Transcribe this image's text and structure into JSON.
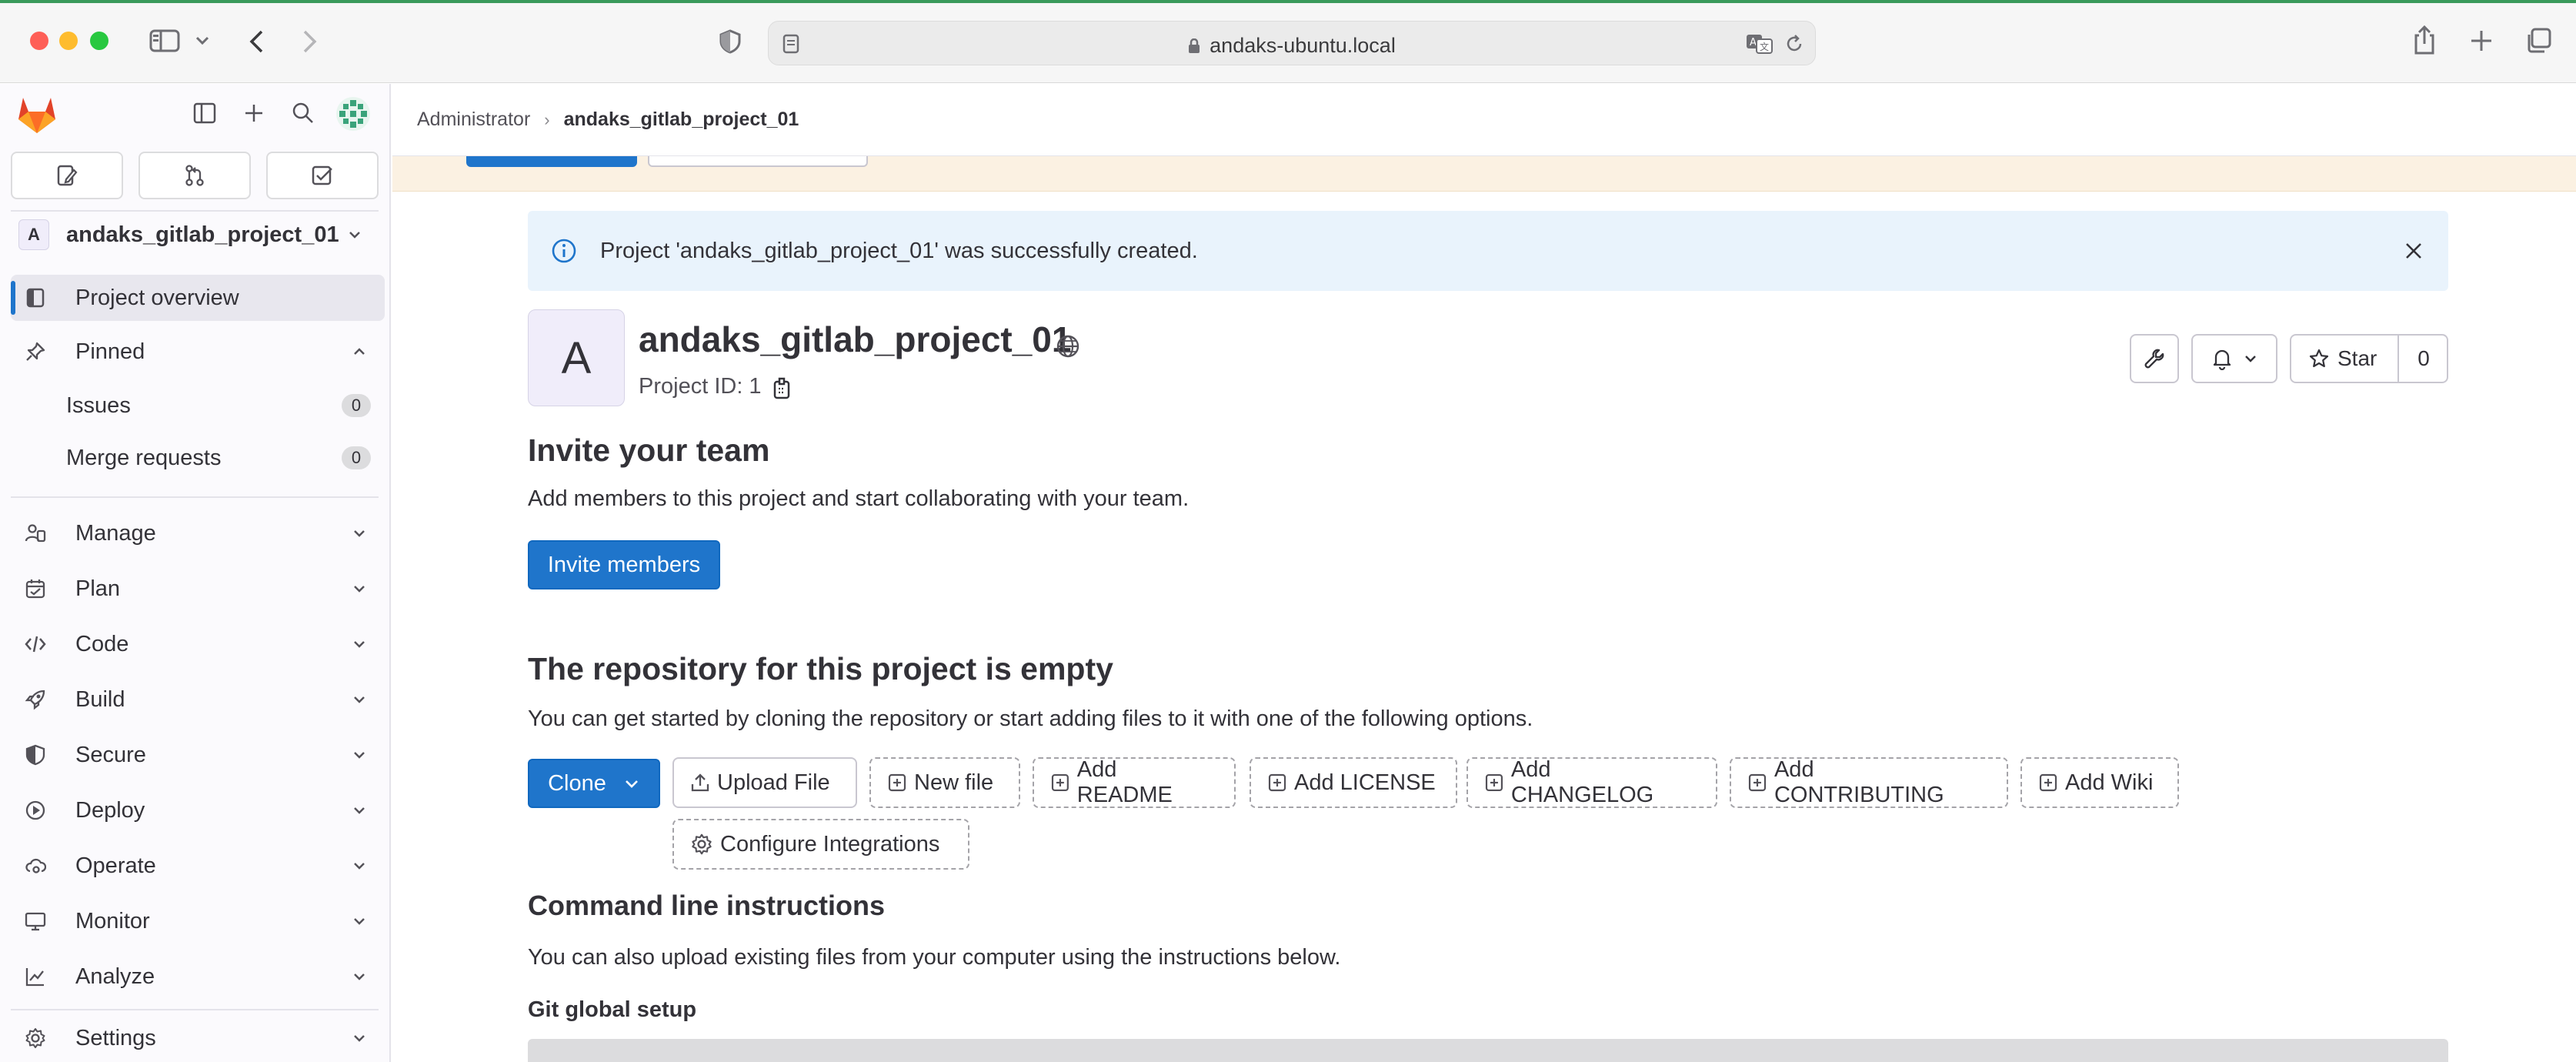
{
  "browser": {
    "url": "andaks-ubuntu.local"
  },
  "breadcrumb": {
    "root": "Administrator",
    "separator": "›",
    "current": "andaks_gitlab_project_01"
  },
  "sidebar": {
    "project_initial": "A",
    "project_name": "andaks_gitlab_project_01",
    "overview_label": "Project overview",
    "pinned_label": "Pinned",
    "pinned_items": [
      {
        "label": "Issues",
        "count": "0"
      },
      {
        "label": "Merge requests",
        "count": "0"
      }
    ],
    "sections": [
      {
        "label": "Manage",
        "icon": "users-icon"
      },
      {
        "label": "Plan",
        "icon": "calendar-icon"
      },
      {
        "label": "Code",
        "icon": "code-icon"
      },
      {
        "label": "Build",
        "icon": "rocket-icon"
      },
      {
        "label": "Secure",
        "icon": "shield-icon"
      },
      {
        "label": "Deploy",
        "icon": "deployments-icon"
      },
      {
        "label": "Operate",
        "icon": "cloud-gear-icon"
      },
      {
        "label": "Monitor",
        "icon": "monitor-icon"
      },
      {
        "label": "Analyze",
        "icon": "chart-icon"
      },
      {
        "label": "Settings",
        "icon": "gear-icon"
      }
    ]
  },
  "alert": {
    "message": "Project 'andaks_gitlab_project_01' was successfully created."
  },
  "project": {
    "initial": "A",
    "title": "andaks_gitlab_project_01",
    "id_label": "Project ID: 1",
    "star_label": "Star",
    "star_count": "0"
  },
  "invite": {
    "heading": "Invite your team",
    "description": "Add members to this project and start collaborating with your team.",
    "button": "Invite members"
  },
  "empty_repo": {
    "heading": "The repository for this project is empty",
    "description": "You can get started by cloning the repository or start adding files to it with one of the following options.",
    "clone_label": "Clone",
    "upload_label": "Upload File",
    "actions": [
      "New file",
      "Add README",
      "Add LICENSE",
      "Add CHANGELOG",
      "Add CONTRIBUTING",
      "Add Wiki"
    ],
    "configure_label": "Configure Integrations"
  },
  "cli": {
    "heading": "Command line instructions",
    "description": "You can also upload existing files from your computer using the instructions below.",
    "global_setup": "Git global setup"
  },
  "colors": {
    "primary": "#1f75cb",
    "alert_bg": "#e9f3fc",
    "warning_bg": "#fbf1e2"
  }
}
